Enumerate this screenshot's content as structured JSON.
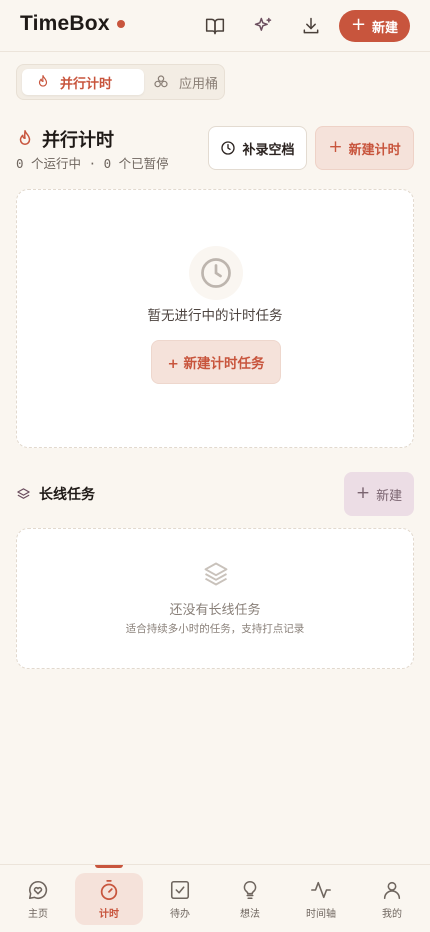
{
  "header": {
    "brand": "TimeBox",
    "new_label": "新建",
    "icons": [
      "book-icon",
      "sparkle-icon",
      "download-icon"
    ]
  },
  "tabs": [
    {
      "label": "并行计时",
      "icon": "flame-icon",
      "active": true
    },
    {
      "label": "应用桶",
      "icon": "buckets-icon",
      "active": false
    }
  ],
  "parallel": {
    "title": "并行计时",
    "status": "0 个运行中 · 0 个已暂停",
    "backfill_label": "补录空档",
    "new_timer_label": "新建计时",
    "empty_text": "暂无进行中的计时任务",
    "empty_button": "+ 新建计时任务"
  },
  "long_tasks": {
    "title": "长线任务",
    "new_label": "新建",
    "empty_title": "还没有长线任务",
    "empty_sub": "适合持续多小时的任务，支持打点记录"
  },
  "bottom_nav": [
    {
      "label": "主页",
      "icon": "chat-heart-icon"
    },
    {
      "label": "计时",
      "icon": "stopwatch-icon",
      "active": true
    },
    {
      "label": "待办",
      "icon": "checkbox-icon"
    },
    {
      "label": "想法",
      "icon": "lightbulb-icon"
    },
    {
      "label": "时间轴",
      "icon": "activity-icon"
    },
    {
      "label": "我的",
      "icon": "user-icon"
    }
  ],
  "colors": {
    "accent": "#c8553d",
    "accent_soft": "#f5e2da",
    "background": "#faf6f0",
    "mauve_soft": "#ecdde5"
  }
}
